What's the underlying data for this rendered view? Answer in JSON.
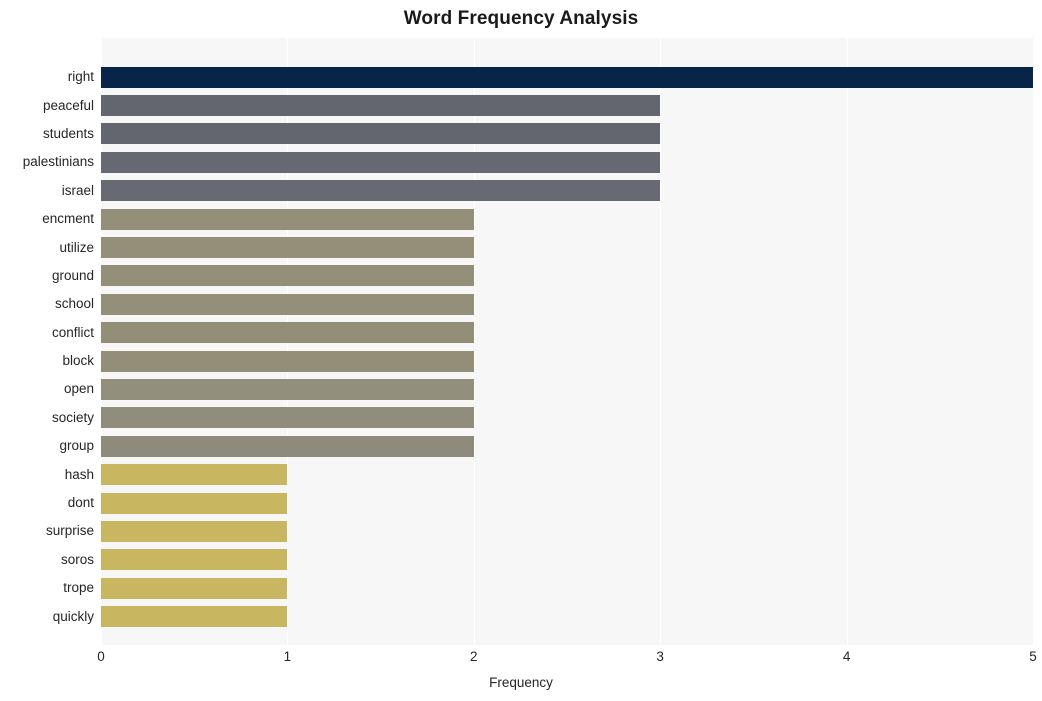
{
  "chart_data": {
    "type": "bar",
    "orientation": "horizontal",
    "title": "Word Frequency Analysis",
    "xlabel": "Frequency",
    "ylabel": "",
    "xlim": [
      0,
      5
    ],
    "xticks": [
      0,
      1,
      2,
      3,
      4,
      5
    ],
    "xticklabels": [
      "0",
      "1",
      "2",
      "3",
      "4",
      "5"
    ],
    "grid": true,
    "grid_axis": "x",
    "legend": false,
    "categories": [
      "right",
      "peaceful",
      "students",
      "palestinians",
      "israel",
      "encment",
      "utilize",
      "ground",
      "school",
      "conflict",
      "block",
      "open",
      "society",
      "group",
      "hash",
      "dont",
      "surprise",
      "soros",
      "trope",
      "quickly"
    ],
    "values": [
      5,
      3,
      3,
      3,
      3,
      2,
      2,
      2,
      2,
      2,
      2,
      2,
      2,
      2,
      1,
      1,
      1,
      1,
      1,
      1
    ],
    "bar_colors": [
      "#082449",
      "#63666f",
      "#63666f",
      "#666972",
      "#676a72",
      "#948f78",
      "#948f78",
      "#948f78",
      "#948f78",
      "#938e78",
      "#938e78",
      "#92907c",
      "#908d7d",
      "#8e8b7c",
      "#c9b660",
      "#c9b660",
      "#c9b660",
      "#c9b660",
      "#c9b660",
      "#c9b660"
    ]
  },
  "style": {
    "plot_background": "#f7f7f7",
    "figure_background": "#ffffff",
    "gridline_color": "#ffffff",
    "text_color": "#262626",
    "title_color": "#1a1a1a"
  }
}
